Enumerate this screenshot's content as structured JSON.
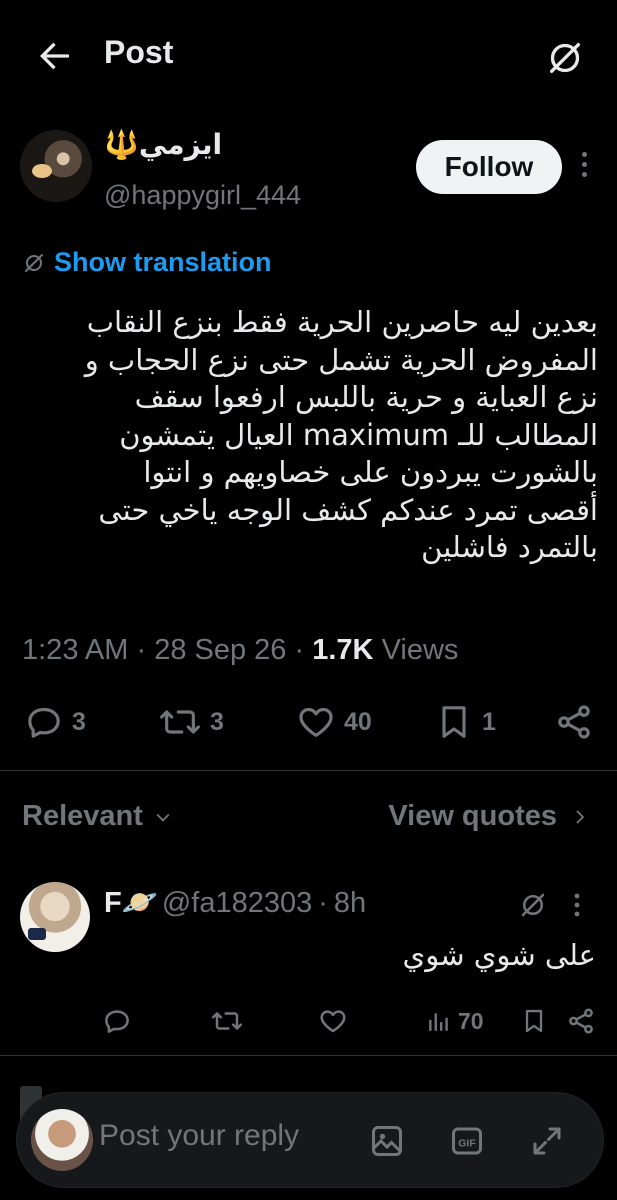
{
  "header": {
    "title": "Post",
    "back_icon": "arrow-left-icon",
    "grok_icon": "grok-icon"
  },
  "author": {
    "name": "ايزمي🔱",
    "handle": "@happygirl_444",
    "follow_label": "Follow"
  },
  "translate": {
    "label": "Show translation"
  },
  "tweet": {
    "text": "بعدين ليه حاصرين الحرية فقط بنزع النقاب\nالمفروض الحرية تشمل حتى نزع الحجاب و\nنزع العباية و حرية باللبس ارفعوا سقف\nالمطالب للـ maximum العيال يتمشون\nبالشورت يبردون على خصاويهم و انتوا\nأقصى تمرد عندكم كشف الوجه ياخي حتى\nبالتمرد فاشلين",
    "time": "1:23 AM",
    "date": "28 Sep 26",
    "views_count": "1.7K",
    "views_label": "Views",
    "sep": "·"
  },
  "actions": {
    "replies": "3",
    "reposts": "3",
    "likes": "40",
    "bookmarks": "1"
  },
  "sort": {
    "relevant": "Relevant",
    "view_quotes": "View quotes"
  },
  "reply": {
    "name": "F🪐",
    "handle": "@fa182303",
    "time": "8h",
    "sep": "·",
    "text": "على شوي شوي",
    "likes": "",
    "views": "70"
  },
  "composer": {
    "placeholder": "Post your reply"
  },
  "colors": {
    "accent": "#1d9bf0",
    "muted": "#71767b",
    "text": "#e7e9ea",
    "bg": "#000000"
  }
}
